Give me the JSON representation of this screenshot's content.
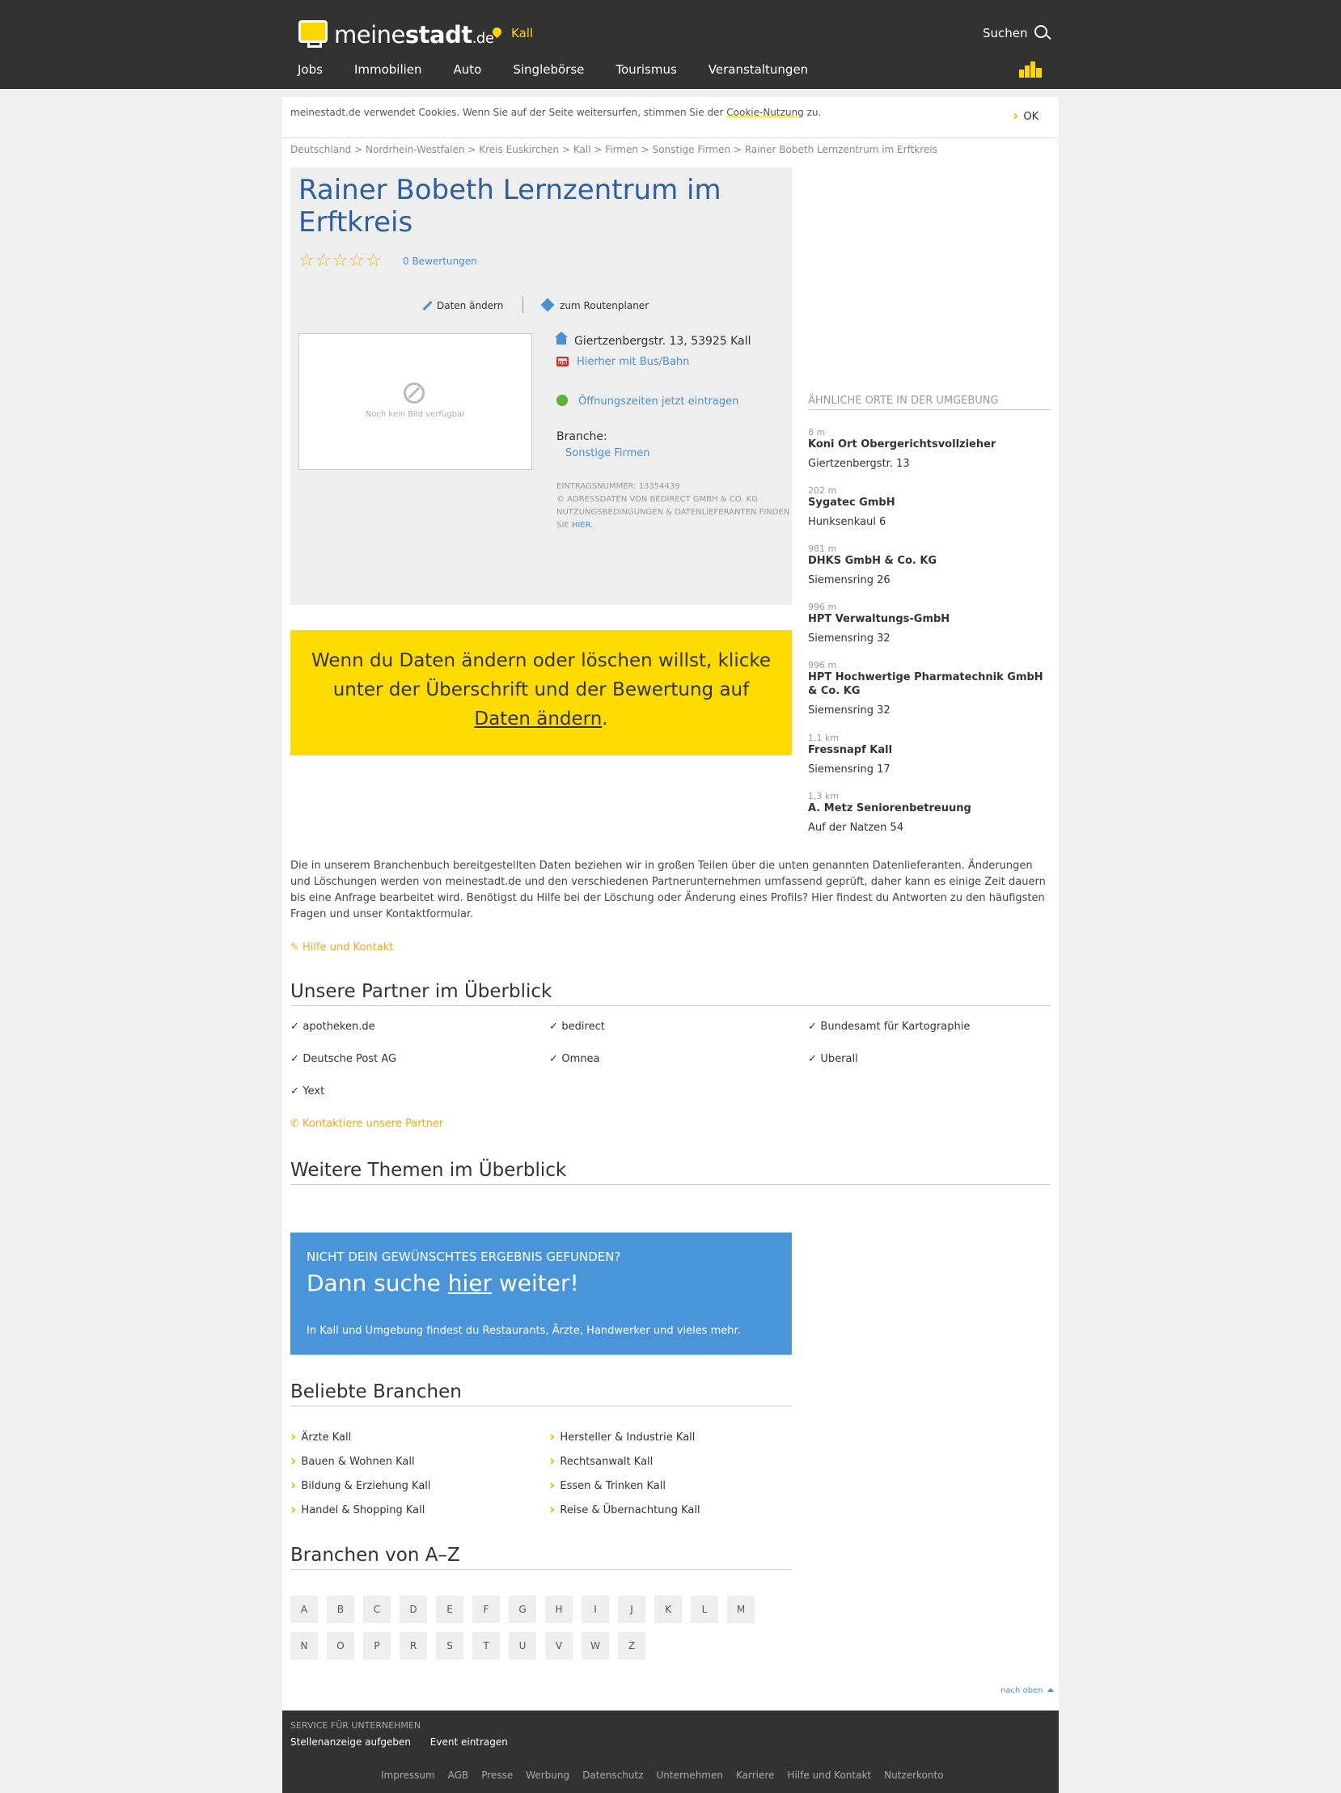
{
  "header": {
    "logo": {
      "word_a": "meine",
      "word_b": "stadt",
      "tld": ".de"
    },
    "city": "Kall",
    "search_label": "Suchen",
    "nav": [
      "Jobs",
      "Immobilien",
      "Auto",
      "Singlebörse",
      "Tourismus",
      "Veranstaltungen"
    ],
    "accent_color": "#ffd700"
  },
  "cookie": {
    "text_before": "meinestadt.de verwendet Cookies. Wenn Sie auf der Seite weitersurfen, stimmen Sie der ",
    "link": "Cookie-Nutzung",
    "text_after": " zu.",
    "ok": "OK"
  },
  "breadcrumb": [
    "Deutschland",
    "Nordrhein-Westfalen",
    "Kreis Euskirchen",
    "Kall",
    "Firmen",
    "Sonstige Firmen",
    "Rainer Bobeth Lernzentrum im Erftkreis"
  ],
  "entry": {
    "title": "Rainer Bobeth Lernzentrum im Erftkreis",
    "stars": "☆☆☆☆☆",
    "rating": 0,
    "rating_max": 5,
    "rating_link": "0 Bewertungen",
    "edit_label": "Daten ändern",
    "route_label": "zum Routenplaner",
    "no_image_text": "Noch kein Bild verfügbar",
    "address": "Giertzenbergstr. 13, 53925 Kall",
    "bus_link": "Hierher mit Bus/Bahn",
    "db_badge": "DB",
    "hours_link": "Öffnungszeiten jetzt eintragen",
    "branche_label": "Branche:",
    "branche_value": "Sonstige Firmen",
    "meta_id": "EINTRAGSNUMMER: 13354439",
    "meta_copy": "© ADRESSDATEN VON BEDIRECT GMBH & CO. KG",
    "meta_terms": "NUTZUNGSBEDINGUNGEN & DATENLIEFERANTEN FINDEN SIE ",
    "meta_link": "HIER",
    "meta_end": "."
  },
  "notice": {
    "text": "Wenn du Daten ändern oder löschen willst, klicke unter der Überschrift und der Bewertung auf ",
    "link": "Daten ändern",
    "end": "."
  },
  "nearby": {
    "heading": "ÄHNLICHE ORTE IN DER UMGEBUNG",
    "places": [
      {
        "dist": "8 m",
        "name": "Koni Ort Obergerichtsvollzieher",
        "addr": "Giertzenbergstr. 13"
      },
      {
        "dist": "202 m",
        "name": "Sygatec GmbH",
        "addr": "Hunksenkaul 6"
      },
      {
        "dist": "981 m",
        "name": "DHKS GmbH & Co. KG",
        "addr": "Siemensring 26"
      },
      {
        "dist": "996 m",
        "name": "HPT Verwaltungs-GmbH",
        "addr": "Siemensring 32"
      },
      {
        "dist": "996 m",
        "name": "HPT Hochwertige Pharmatechnik GmbH & Co. KG",
        "addr": "Siemensring 32"
      },
      {
        "dist": "1,1 km",
        "name": "Fressnapf Kall",
        "addr": "Siemensring 17"
      },
      {
        "dist": "1,3 km",
        "name": "A. Metz Seniorenbetreuung",
        "addr": "Auf der Natzen 54"
      }
    ]
  },
  "info_paragraph": "Die in unserem Branchenbuch bereitgestellten Daten beziehen wir in großen Teilen über die unten genannten Datenlieferanten. Änderungen und Löschungen werden von meinestadt.de und den verschiedenen Partnerunternehmen umfassend geprüft, daher kann es einige Zeit dauern bis eine Anfrage bearbeitet wird. Benötigst du Hilfe bei der Löschung oder Änderung eines Profils? Hier findest du Antworten zu den häufigsten Fragen und unser Kontaktformular.",
  "help_link": "✎ Hilfe und Kontakt",
  "partners": {
    "heading": "Unsere Partner im Überblick",
    "items": [
      "apotheken.de",
      "bedirect",
      "Bundesamt für Kartographie",
      "Deutsche Post AG",
      "Omnea",
      "Uberall",
      "Yext"
    ],
    "contact_link": "✆ Kontaktiere unsere Partner"
  },
  "topics_heading": "Weitere Themen im Überblick",
  "search_box": {
    "subtitle": "NICHT DEIN GEWÜNSCHTES ERGEBNIS GEFUNDEN?",
    "title_before": "Dann suche ",
    "title_link": "hier",
    "title_after": " weiter!",
    "note": "In Kall und Umgebung findest du Restaurants, Ärzte, Handwerker und vieles mehr."
  },
  "popular": {
    "heading": "Beliebte Branchen",
    "left": [
      "Ärzte Kall",
      "Bauen & Wohnen Kall",
      "Bildung & Erziehung Kall",
      "Handel & Shopping Kall"
    ],
    "right": [
      "Hersteller & Industrie Kall",
      "Rechtsanwalt Kall",
      "Essen & Trinken Kall",
      "Reise & Übernachtung Kall"
    ]
  },
  "az": {
    "heading": "Branchen von A–Z",
    "letters": [
      "A",
      "B",
      "C",
      "D",
      "E",
      "F",
      "G",
      "H",
      "I",
      "J",
      "K",
      "L",
      "M",
      "N",
      "O",
      "P",
      "R",
      "S",
      "T",
      "U",
      "V",
      "W",
      "Z"
    ]
  },
  "back_to_top": "nach oben",
  "footer": {
    "heading": "SERVICE FÜR UNTERNEHMEN",
    "links": [
      "Stellenanzeige aufgeben",
      "Event eintragen"
    ],
    "legal": [
      "Impressum",
      "AGB",
      "Presse",
      "Werbung",
      "Datenschutz",
      "Unternehmen",
      "Karriere",
      "Hilfe und Kontakt",
      "Nutzerkonto"
    ]
  }
}
